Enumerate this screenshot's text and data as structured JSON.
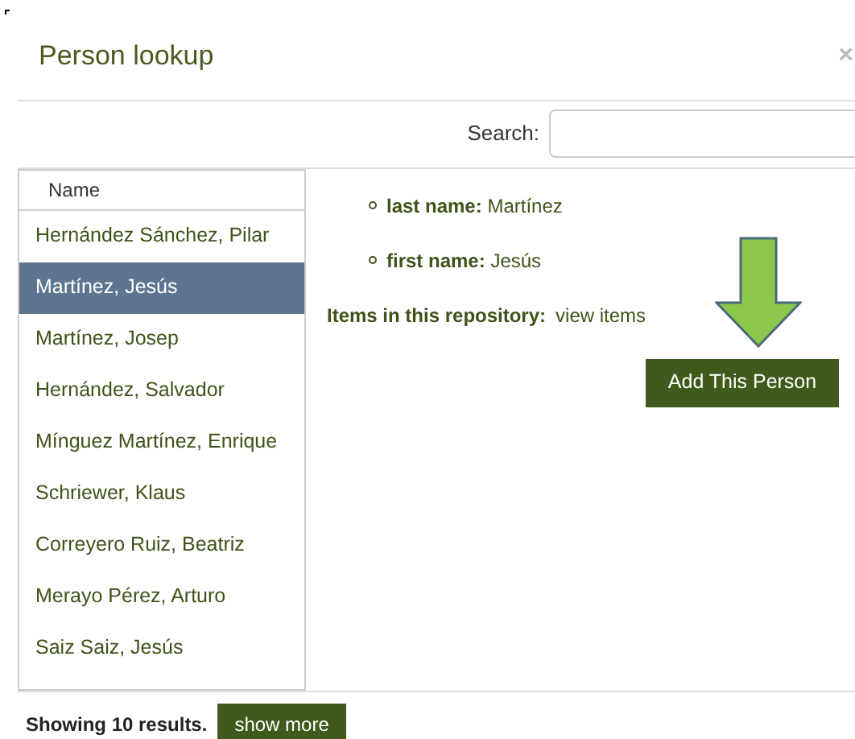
{
  "dialog": {
    "title": "Person lookup",
    "close": "×"
  },
  "search": {
    "label": "Search:"
  },
  "list": {
    "header": "Name",
    "items": [
      {
        "name": "Hernández Sánchez, Pilar",
        "selected": false
      },
      {
        "name": "Martínez, Jesús",
        "selected": true
      },
      {
        "name": "Martínez, Josep",
        "selected": false
      },
      {
        "name": "Hernández, Salvador",
        "selected": false
      },
      {
        "name": "Mínguez Martínez, Enrique",
        "selected": false
      },
      {
        "name": "Schriewer, Klaus",
        "selected": false
      },
      {
        "name": "Correyero Ruiz, Beatriz",
        "selected": false
      },
      {
        "name": "Merayo Pérez, Arturo",
        "selected": false
      },
      {
        "name": "Saiz Saiz, Jesús",
        "selected": false
      }
    ]
  },
  "details": {
    "fields": [
      "**last name:** Martínez",
      "**first name:** Jesús"
    ],
    "items_label": "Items in this repository:",
    "items_link": "view items",
    "add_button": "Add This Person"
  },
  "footer": {
    "count": "Showing 10 results.",
    "more_button": "show more"
  }
}
